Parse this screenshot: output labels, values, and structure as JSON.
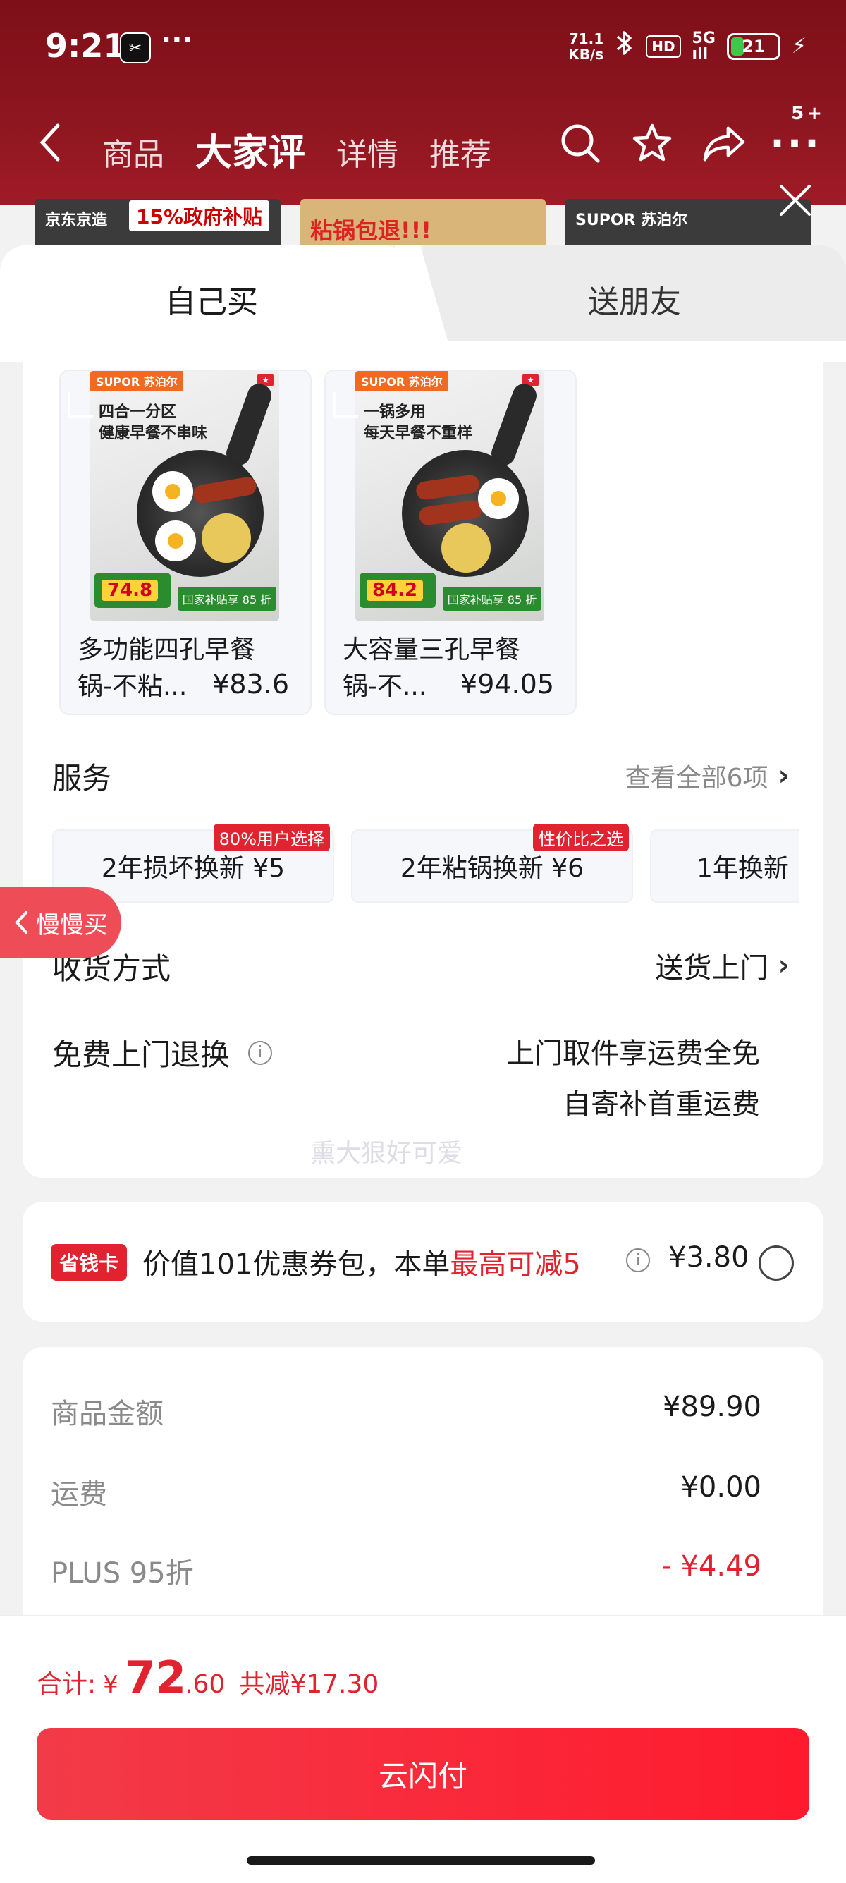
{
  "status_bar": {
    "time": "9:21",
    "app_icon_label": "✂",
    "dots": "···",
    "net_speed_top": "71.1",
    "net_speed_bottom": "KB/s",
    "hd": "HD",
    "signal_top": "5G",
    "signal_bottom": "ıll",
    "battery": "21"
  },
  "nav": {
    "tabs": [
      {
        "label": "商品"
      },
      {
        "label": "大家评"
      },
      {
        "label": "详情"
      },
      {
        "label": "推荐"
      }
    ],
    "more_count": "5+"
  },
  "strip": {
    "item1_text": "京东京造",
    "item1_badge": "15%政府补贴",
    "item2_text": "粘锅包退!!!",
    "item3_text": "SUPOR 苏泊尔"
  },
  "sheet": {
    "tabs": {
      "self": "自己买",
      "friend": "送朋友"
    },
    "products": [
      {
        "brand": "SUPOR 苏泊尔",
        "headline_1": "四合一分区",
        "headline_2": "健康早餐不串味",
        "price_tag": "74.8",
        "subsidy": "国家补贴享 85 折",
        "name_line1": "多功能四孔早餐",
        "name_line2": "锅-不粘...",
        "price": "¥83.6"
      },
      {
        "brand": "SUPOR 苏泊尔",
        "headline_1": "一锅多用",
        "headline_2": "每天早餐不重样",
        "price_tag": "84.2",
        "subsidy": "国家补贴享 85 折",
        "name_line1": "大容量三孔早餐",
        "name_line2": "锅-不...",
        "price": "¥94.05"
      }
    ],
    "slow_buy": "慢慢买",
    "service": {
      "label": "服务",
      "view_all": "查看全部6项",
      "items": [
        {
          "label": "2年损坏换新  ¥5",
          "tag": "80%用户选择"
        },
        {
          "label": "2年粘锅换新  ¥6",
          "tag": "性价比之选"
        },
        {
          "label": "1年换新",
          "tag": ""
        }
      ]
    },
    "watermark": "熏大狠好可爱",
    "delivery": {
      "label": "收货方式",
      "value": "送货上门"
    },
    "free_return": {
      "label": "免费上门退换",
      "line1": "上门取件享运费全免",
      "line2": "自寄补首重运费"
    },
    "coupon": {
      "badge": "省钱卡",
      "text_prefix": "价值101优惠券包，本单",
      "text_red": "最高可减5",
      "price": "¥3.80"
    },
    "summary": [
      {
        "label": "商品金额",
        "value": "¥89.90",
        "red": false
      },
      {
        "label": "运费",
        "value": "¥0.00",
        "red": false
      },
      {
        "label": "PLUS 95折",
        "value": "- ¥4.49",
        "red": true
      }
    ]
  },
  "bottom": {
    "total_label": "合计:",
    "yen": "¥",
    "total_int": "72",
    "total_dec": ".60",
    "saved": "共减¥17.30",
    "pay_button": "云闪付"
  },
  "colors": {
    "accent_red": "#e0232f",
    "header_dark_red": "#8e1620"
  }
}
